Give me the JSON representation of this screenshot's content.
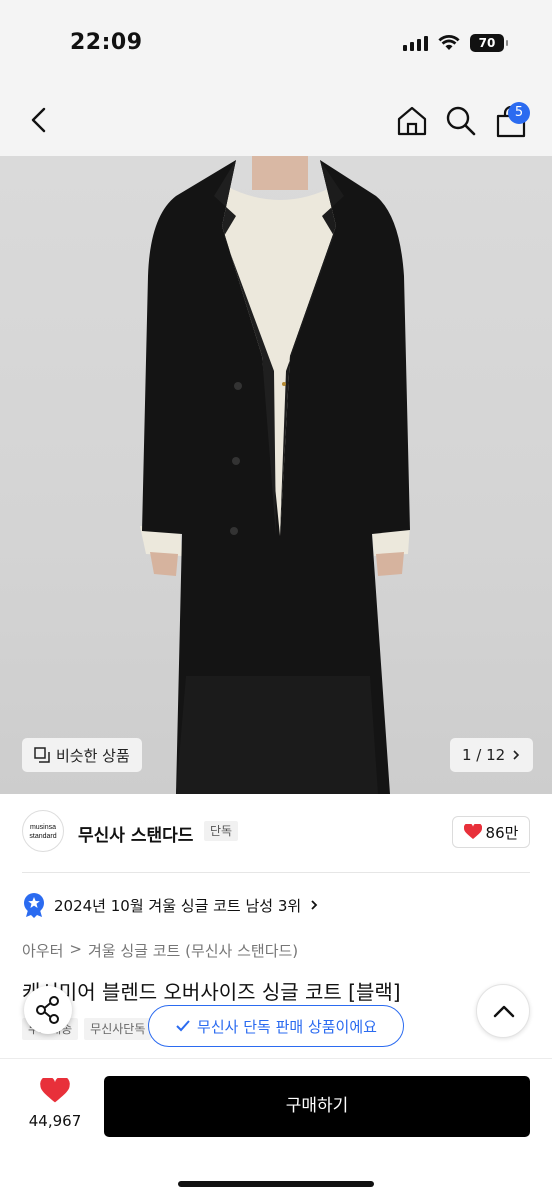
{
  "status": {
    "time": "22:09",
    "battery": "70"
  },
  "nav": {
    "cart_count": "5"
  },
  "image": {
    "similar_label": "비슷한 상품",
    "page": "1 / 12"
  },
  "brand": {
    "logo_line1": "musinsa",
    "logo_line2": "standard",
    "name": "무신사 스탠다드",
    "tag": "단독",
    "likes": "86만"
  },
  "ranking": {
    "text": "2024년 10월 겨울 싱글 코트 남성 3위"
  },
  "breadcrumb": {
    "level1": "아우터",
    "sep": ">",
    "level2": "겨울 싱글 코트 (무신사 스탠다드)"
  },
  "product": {
    "title": "캐시미어 블렌드 오버사이즈 싱글 코트 [블랙]",
    "tag1": "무료배송",
    "tag2": "무신사단독"
  },
  "toast": {
    "text": "무신사 단독 판매 상품이에요"
  },
  "footer": {
    "wish_count": "44,967",
    "buy_label": "구매하기"
  },
  "colors": {
    "accent": "#2b6bf0",
    "heart": "#e8303a",
    "primary_button": "#000000"
  }
}
